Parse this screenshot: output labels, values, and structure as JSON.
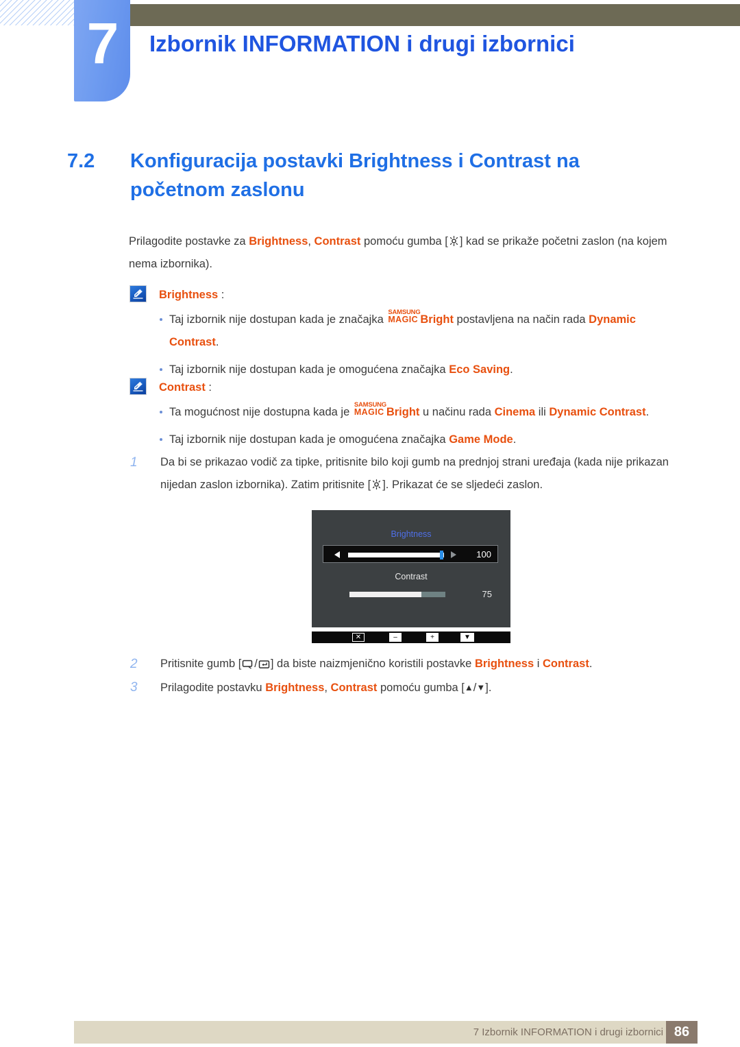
{
  "chapter": {
    "number": "7",
    "title": "Izbornik INFORMATION i drugi izbornici"
  },
  "section": {
    "number": "7.2",
    "title_line1": "Konfiguracija postavki Brightness i Contrast na",
    "title_line2": "početnom zaslonu"
  },
  "intro": {
    "part1": "Prilagodite postavke za ",
    "kw1": "Brightness",
    "comma": ", ",
    "kw2": "Contrast",
    "part2": " pomoću gumba [",
    "icon": "brightness-sun-icon",
    "part3": "] kad se prikaže početni zaslon (na kojem nema izbornika)."
  },
  "notes": [
    {
      "icon": "note-pencil-icon",
      "heading": "Brightness",
      "colon": " :",
      "bullets": [
        {
          "pre": "Taj izbornik nije dostupan kada je značajka ",
          "magic_top": "SAMSUNG",
          "magic_bottom": "MAGIC",
          "magic_word": "Bright",
          "mid": " postavljena na način rada ",
          "kw": "Dynamic Contrast",
          "post": "."
        },
        {
          "pre": "Taj izbornik nije dostupan kada je omogućena značajka ",
          "kw": "Eco Saving",
          "post": "."
        }
      ]
    },
    {
      "icon": "note-pencil-icon",
      "heading": "Contrast",
      "colon": " :",
      "bullets": [
        {
          "pre": "Ta mogućnost nije dostupna kada je ",
          "magic_top": "SAMSUNG",
          "magic_bottom": "MAGIC",
          "magic_word": "Bright",
          "mid": " u načinu rada ",
          "kw": "Cinema",
          "mid2": " ili ",
          "kw2": "Dynamic Contrast",
          "post": "."
        },
        {
          "pre": "Taj izbornik nije dostupan kada je omogućena značajka ",
          "kw": "Game Mode",
          "post": "."
        }
      ]
    }
  ],
  "steps": [
    {
      "num": "1",
      "pre": "Da bi se prikazao vodič za tipke, pritisnite bilo koji gumb na prednjoj strani uređaja (kada nije prikazan nijedan zaslon izbornika). Zatim pritisnite [",
      "icon": "brightness-sun-icon",
      "post": "]. Prikazat će se sljedeći zaslon."
    },
    {
      "num": "2",
      "pre": "Pritisnite gumb [",
      "icon1": "monitor-button-icon",
      "sep": "/",
      "icon2": "enter-button-icon",
      "mid": "] da biste naizmjenično koristili postavke ",
      "kw1": "Brightness",
      "conj": " i ",
      "kw2": "Contrast",
      "post": "."
    },
    {
      "num": "3",
      "pre": "Prilagodite postavku ",
      "kw1": "Brightness",
      "comma": ", ",
      "kw2": "Contrast",
      "mid": " pomoću gumba [",
      "up": "▲",
      "slash": "/",
      "down": "▼",
      "post": "]."
    }
  ],
  "osd": {
    "brightness_label": "Brightness",
    "brightness_value": "100",
    "brightness_percent": 100,
    "contrast_label": "Contrast",
    "contrast_value": "75",
    "contrast_percent": 75,
    "buttons": [
      {
        "name": "close-button",
        "glyph": "✕"
      },
      {
        "name": "minus-button",
        "glyph": "–"
      },
      {
        "name": "plus-button",
        "glyph": "+"
      },
      {
        "name": "down-button",
        "glyph": "▼"
      }
    ]
  },
  "footer": {
    "text": "7 Izbornik INFORMATION i drugi izbornici",
    "page": "86"
  },
  "colors": {
    "accent_blue": "#1f6fe5",
    "keyword_orange": "#e8500f",
    "header_olive": "#6d6a55",
    "tab_blue": "#6f9cf0",
    "footer_beige": "#ded8c4",
    "footer_page_box": "#8a7a6d",
    "osd_bg": "#3c4042",
    "osd_highlight": "#4f6fe8"
  }
}
